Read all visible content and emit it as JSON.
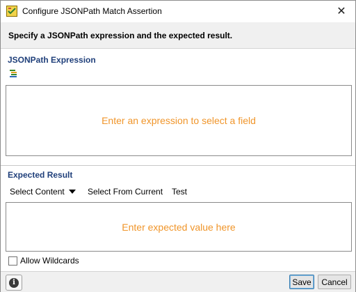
{
  "window": {
    "title": "Configure JSONPath Match Assertion",
    "close_glyph": "✕"
  },
  "header": {
    "text": "Specify a JSONPath expression and the expected result."
  },
  "expression": {
    "label": "JSONPath Expression",
    "tool_icon": "select-fields-icon",
    "placeholder": "Enter an expression to select a field"
  },
  "expected": {
    "label": "Expected Result",
    "toolbar": {
      "select_content": "Select Content",
      "select_from_current": "Select From Current",
      "test": "Test"
    },
    "placeholder": "Enter expected value here"
  },
  "allow_wildcards": {
    "label": "Allow Wildcards",
    "checked": false
  },
  "footer": {
    "info_icon": "info-icon",
    "info_glyph": "i",
    "save": "Save",
    "cancel": "Cancel"
  },
  "colors": {
    "placeholder": "#f0952a",
    "section_label": "#1f3f7a"
  }
}
